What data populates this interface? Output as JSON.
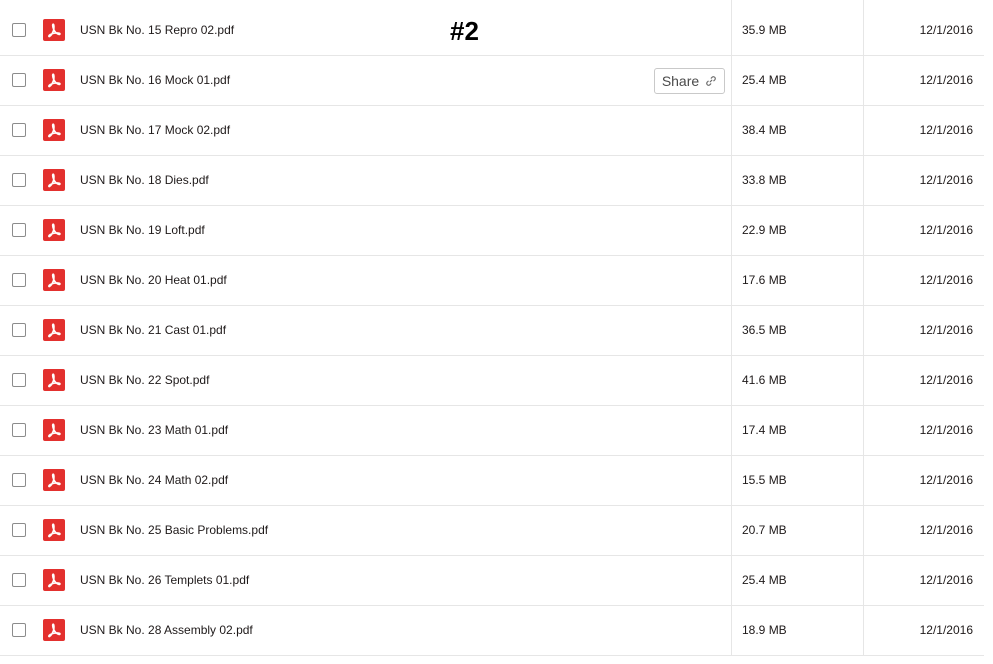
{
  "annotation": "#2",
  "share_label": "Share",
  "icons": {
    "file_type": "pdf-icon",
    "share": "link-icon"
  },
  "colors": {
    "pdf_icon": "#e3302e",
    "divider": "#e6e6e6"
  },
  "files": [
    {
      "name": "USN Bk No. 15 Repro 02.pdf",
      "size": "35.9 MB",
      "modified": "12/1/2016"
    },
    {
      "name": "USN Bk No. 16 Mock 01.pdf",
      "size": "25.4 MB",
      "modified": "12/1/2016"
    },
    {
      "name": "USN Bk No. 17 Mock 02.pdf",
      "size": "38.4 MB",
      "modified": "12/1/2016"
    },
    {
      "name": "USN Bk No. 18 Dies.pdf",
      "size": "33.8 MB",
      "modified": "12/1/2016"
    },
    {
      "name": "USN Bk No. 19 Loft.pdf",
      "size": "22.9 MB",
      "modified": "12/1/2016"
    },
    {
      "name": "USN Bk No. 20 Heat 01.pdf",
      "size": "17.6 MB",
      "modified": "12/1/2016"
    },
    {
      "name": "USN Bk No. 21 Cast 01.pdf",
      "size": "36.5 MB",
      "modified": "12/1/2016"
    },
    {
      "name": "USN Bk No. 22 Spot.pdf",
      "size": "41.6 MB",
      "modified": "12/1/2016"
    },
    {
      "name": "USN Bk No. 23 Math 01.pdf",
      "size": "17.4 MB",
      "modified": "12/1/2016"
    },
    {
      "name": "USN Bk No. 24 Math 02.pdf",
      "size": "15.5 MB",
      "modified": "12/1/2016"
    },
    {
      "name": "USN Bk No. 25 Basic Problems.pdf",
      "size": "20.7 MB",
      "modified": "12/1/2016"
    },
    {
      "name": "USN Bk No. 26 Templets 01.pdf",
      "size": "25.4 MB",
      "modified": "12/1/2016"
    },
    {
      "name": "USN Bk No. 28 Assembly 02.pdf",
      "size": "18.9 MB",
      "modified": "12/1/2016"
    }
  ]
}
